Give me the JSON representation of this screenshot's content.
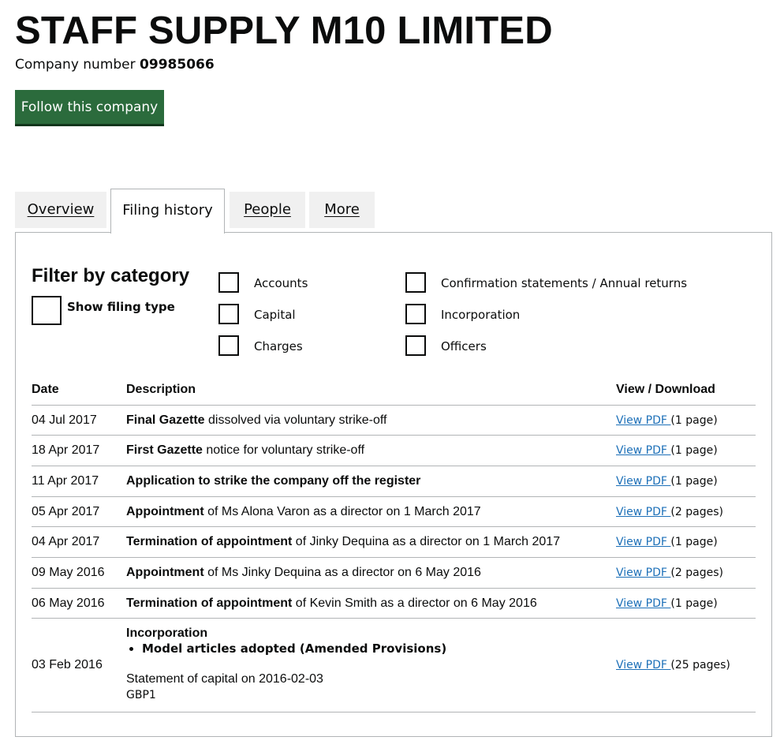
{
  "company": {
    "name": "STAFF SUPPLY M10 LIMITED",
    "number_label": "Company number",
    "number": "09985066"
  },
  "follow_button": "Follow this company",
  "tabs": [
    {
      "label": "Overview",
      "active": false
    },
    {
      "label": "Filing history",
      "active": true
    },
    {
      "label": "People",
      "active": false
    },
    {
      "label": "More",
      "active": false
    }
  ],
  "filter": {
    "heading": "Filter by category",
    "show_filing_type": "Show filing type",
    "categories": [
      {
        "label": "Accounts",
        "checked": false
      },
      {
        "label": "Capital",
        "checked": false
      },
      {
        "label": "Charges",
        "checked": false
      },
      {
        "label": "Confirmation statements / Annual returns",
        "checked": false
      },
      {
        "label": "Incorporation",
        "checked": false
      },
      {
        "label": "Officers",
        "checked": false
      }
    ]
  },
  "table": {
    "headers": {
      "date": "Date",
      "description": "Description",
      "view": "View / Download"
    },
    "rows": [
      {
        "date": "04 Jul 2017",
        "bold": "Final Gazette",
        "text": " dissolved via voluntary strike-off",
        "link": "View PDF ",
        "pages": "(1 page)"
      },
      {
        "date": "18 Apr 2017",
        "bold": "First Gazette",
        "text": " notice for voluntary strike-off",
        "link": "View PDF ",
        "pages": "(1 page)"
      },
      {
        "date": "11 Apr 2017",
        "bold": "Application to strike the company off the register",
        "text": "",
        "link": "View PDF ",
        "pages": "(1 page)"
      },
      {
        "date": "05 Apr 2017",
        "bold": "Appointment",
        "text": " of Ms Alona Varon as a director on 1 March 2017",
        "link": "View PDF ",
        "pages": "(2 pages)"
      },
      {
        "date": "04 Apr 2017",
        "bold": "Termination of appointment",
        "text": " of Jinky Dequina as a director on 1 March 2017",
        "link": "View PDF ",
        "pages": "(1 page)"
      },
      {
        "date": "09 May 2016",
        "bold": "Appointment",
        "text": " of Ms Jinky Dequina as a director on 6 May 2016",
        "link": "View PDF ",
        "pages": "(2 pages)"
      },
      {
        "date": "06 May 2016",
        "bold": "Termination of appointment",
        "text": " of Kevin Smith as a director on 6 May 2016",
        "link": "View PDF ",
        "pages": "(1 page)"
      }
    ],
    "incorporation": {
      "date": "03 Feb 2016",
      "title": "Incorporation",
      "bullet": "Model articles adopted (Amended Provisions)",
      "capital": "Statement of capital on 2016-02-03",
      "amount": "GBP1",
      "link": "View PDF ",
      "pages": "(25 pages)"
    }
  }
}
